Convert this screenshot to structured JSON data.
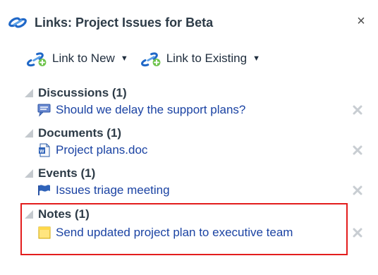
{
  "panel": {
    "title": "Links: Project Issues for Beta",
    "header_icon": "link-icon",
    "close_label": "×"
  },
  "toolbar": {
    "link_to_new_label": "Link to New",
    "link_to_existing_label": "Link to Existing",
    "link_to_new_icon": "add-link-icon",
    "link_to_existing_icon": "add-link-icon",
    "caret_icon": "chevron-down-icon"
  },
  "sections": [
    {
      "title": "Discussions (1)",
      "item_label": "Should we delay the support plans?",
      "icon": "discussion-icon"
    },
    {
      "title": "Documents (1)",
      "item_label": "Project plans.doc",
      "icon": "document-icon"
    },
    {
      "title": "Events (1)",
      "item_label": "Issues triage meeting",
      "icon": "flag-icon"
    },
    {
      "title": "Notes (1)",
      "item_label": "Send updated project plan to executive team",
      "icon": "note-icon"
    }
  ],
  "colors": {
    "text": "#2d3b47",
    "link": "#1b43a3",
    "highlight": "#e31d1d",
    "remove": "#c8cdd2"
  }
}
